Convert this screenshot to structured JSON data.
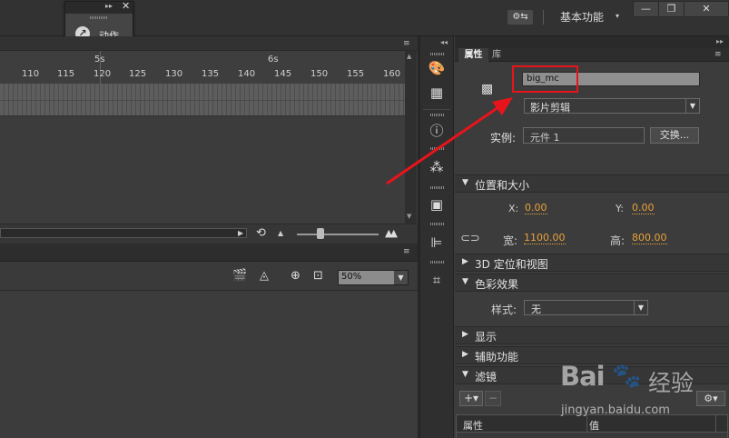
{
  "topbar": {
    "floating_panel_label": "动作",
    "floating_panel_arrows": "▸▸",
    "floating_panel_close": "✕",
    "sync_icon": "sync-settings-icon",
    "workspace_label": "基本功能",
    "workspace_caret": "▾",
    "window_buttons": [
      "—",
      "❐",
      "✕"
    ]
  },
  "timeline": {
    "seconds": [
      "5s",
      "6s"
    ],
    "frame_numbers": [
      "110",
      "115",
      "120",
      "125",
      "130",
      "135",
      "140",
      "145",
      "150",
      "155",
      "160"
    ],
    "menu_icon": "≡"
  },
  "stage": {
    "zoom_value": "50%"
  },
  "properties": {
    "tabs": [
      "属性",
      "库"
    ],
    "instance_name": "big_mc",
    "symbol_type": "影片剪辑",
    "instance_label": "实例:",
    "instance_value": "元件 1",
    "swap_button": "交换...",
    "sections": {
      "position_size": "位置和大小",
      "three_d": "3D 定位和视图",
      "color_effect": "色彩效果",
      "display": "显示",
      "accessibility": "辅助功能",
      "filters": "滤镜"
    },
    "x_label": "X:",
    "x_value": "0.00",
    "y_label": "Y:",
    "y_value": "0.00",
    "width_label": "宽:",
    "width_value": "1100.00",
    "height_label": "高:",
    "height_value": "800.00",
    "style_label": "样式:",
    "style_value": "无",
    "filter_columns": [
      "属性",
      "值"
    ]
  },
  "watermark": {
    "logo": "Bai",
    "logo_suffix": "经验",
    "url": "jingyan.baidu.com"
  },
  "colors": {
    "highlight_box": "#e8141b",
    "value_orange": "#e9a23b"
  }
}
